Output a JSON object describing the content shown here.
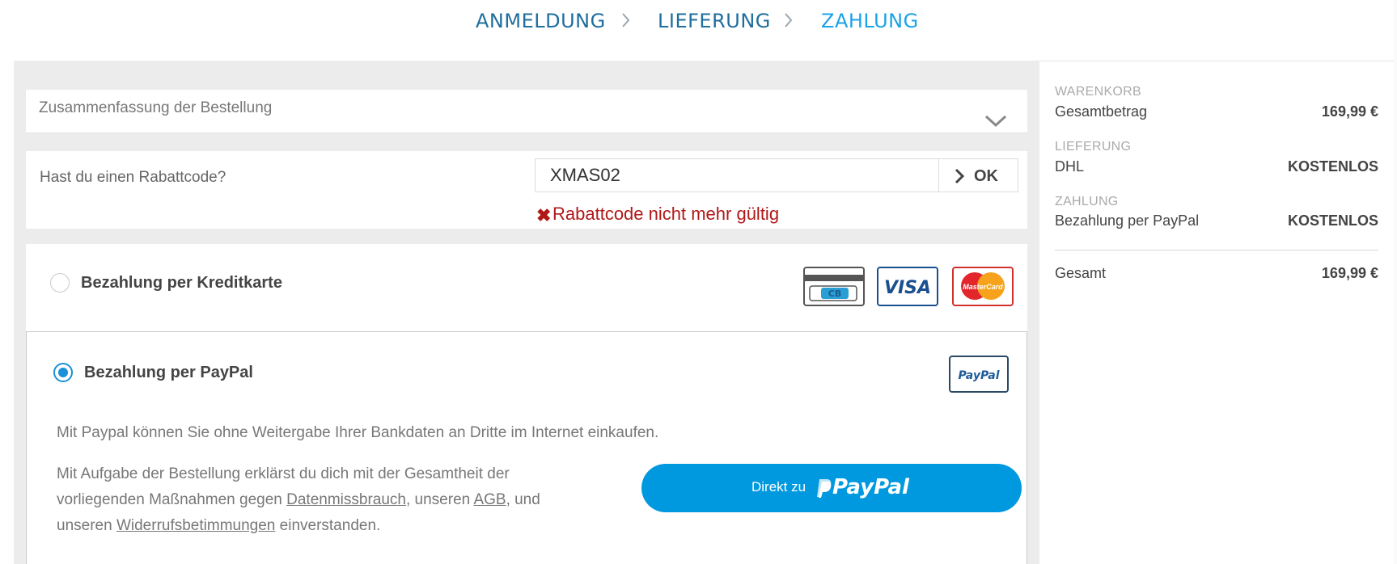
{
  "steps": {
    "login": "ANMELDUNG",
    "delivery": "LIEFERUNG",
    "payment": "ZAHLUNG",
    "active_color": "#1aa3e6",
    "color": "#1f6e9e"
  },
  "summary": {
    "title": "Zusammenfassung der Bestellung"
  },
  "coupon": {
    "question": "Hast du einen Rabattcode?",
    "value": "XMAS02",
    "ok_label": "OK",
    "error": "Rabattcode nicht mehr gültig"
  },
  "payment": {
    "creditcard_label": "Bezahlung per Kreditkarte",
    "creditcard_logos": [
      "cb-card-icon",
      "visa-logo",
      "mastercard-logo"
    ],
    "paypal_label": "Bezahlung per PayPal",
    "paypal_selected": true,
    "paypal_description": "Mit Paypal können Sie ohne Weitergabe Ihrer Bankdaten an Dritte im Internet einkaufen.",
    "legal": {
      "part1": "Mit Aufgabe der Bestellung erklärst du dich mit der Gesamtheit der vorliegenden Maßnahmen gegen ",
      "link1": "Datenmissbrauch",
      "part2": ", unseren ",
      "link2": "AGB",
      "part3": ", und unseren ",
      "link3": "Widerrufsbetimmungen",
      "part4": " einverstanden."
    },
    "button_prefix": "Direkt zu",
    "button_brand": "PayPal",
    "button_color": "#0099e0"
  },
  "sidebar": {
    "cart_heading": "WARENKORB",
    "subtotal_label": "Gesamtbetrag",
    "subtotal_value": "169,99 €",
    "delivery_heading": "LIEFERUNG",
    "delivery_label": "DHL",
    "delivery_value": "KOSTENLOS",
    "payment_heading": "ZAHLUNG",
    "payment_label": "Bezahlung per PayPal",
    "payment_value": "KOSTENLOS",
    "total_label": "Gesamt",
    "total_value": "169,99 €"
  }
}
